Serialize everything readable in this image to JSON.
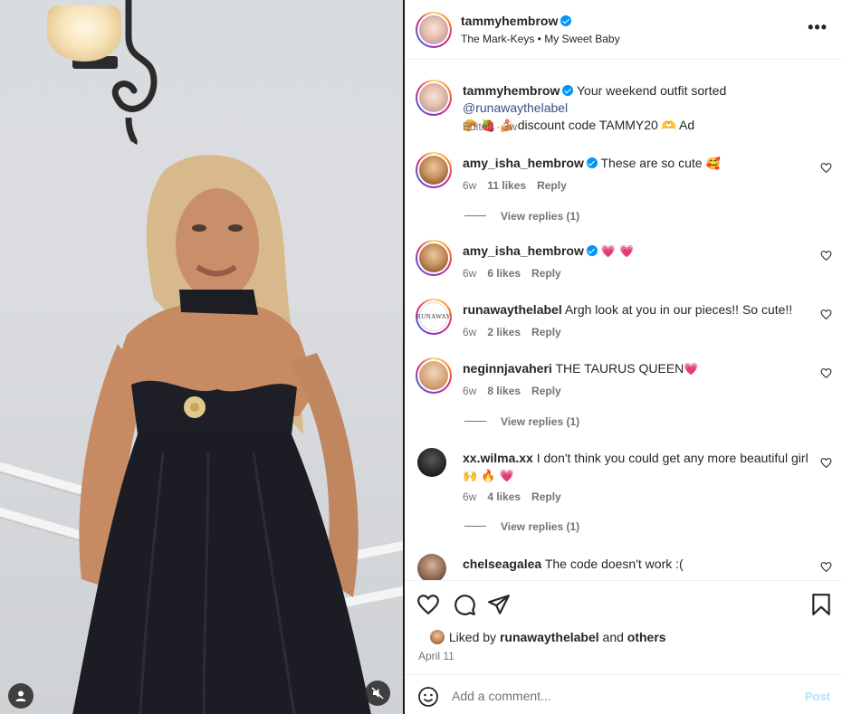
{
  "header": {
    "username": "tammyhembrow",
    "subtitle": "The Mark-Keys • My Sweet Baby",
    "more": "•••"
  },
  "caption": {
    "username": "tammyhembrow",
    "text": "Your weekend outfit sorted ",
    "mention": "@runawaythelabel",
    "emoji_line": "🥐 🍓 🍰",
    "text2": " discount code TAMMY20 ",
    "emoji2": "🫶",
    "text3": " Ad",
    "meta": "Edited · 3w"
  },
  "comments": [
    {
      "username": "amy_isha_hembrow",
      "verified": true,
      "text": "These are so cute ",
      "emoji": "🥰",
      "age": "6w",
      "likes": "11 likes",
      "reply": "Reply",
      "view_replies": "View replies (1)"
    },
    {
      "username": "amy_isha_hembrow",
      "verified": true,
      "text": "",
      "emoji": "💗 💗",
      "age": "6w",
      "likes": "6 likes",
      "reply": "Reply"
    },
    {
      "username": "runawaythelabel",
      "verified": false,
      "text": "Argh look at you in our pieces!! So cute!!",
      "emoji": "",
      "age": "6w",
      "likes": "2 likes",
      "reply": "Reply"
    },
    {
      "username": "neginnjavaheri",
      "verified": false,
      "text": "THE TAURUS QUEEN",
      "emoji": "💗",
      "age": "6w",
      "likes": "8 likes",
      "reply": "Reply",
      "view_replies": "View replies (1)"
    },
    {
      "username": "xx.wilma.xx",
      "verified": false,
      "text": "I don't think you could get any more beautiful girl",
      "emoji": "🙌 🔥 💗",
      "age": "6w",
      "likes": "4 likes",
      "reply": "Reply",
      "view_replies": "View replies (1)"
    },
    {
      "username": "chelseagalea",
      "verified": false,
      "text": "The code doesn't work :(",
      "emoji": ""
    }
  ],
  "avatar_labels": {
    "runaway": "RUNAWAY"
  },
  "likes": {
    "prefix": "Liked by ",
    "user": "runawaythelabel",
    "middle": " and ",
    "others": "others"
  },
  "date": "April 11",
  "add_comment": {
    "placeholder": "Add a comment...",
    "post": "Post"
  }
}
